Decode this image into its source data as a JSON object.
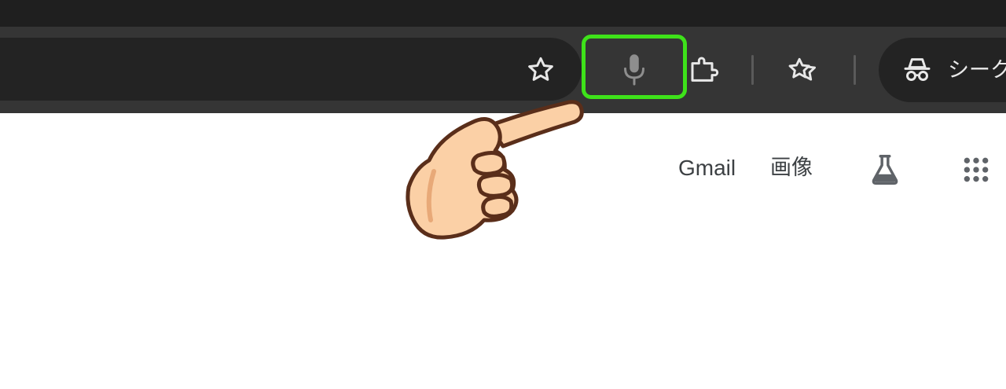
{
  "toolbar": {
    "star_icon": "star-icon",
    "mic_icon": "microphone-icon",
    "extension_icon": "extensions-icon",
    "bookmarks_icon": "bookmarks-icon",
    "profile": {
      "icon": "incognito-icon",
      "label": "シークレ"
    }
  },
  "annotation": {
    "highlight_color": "#3ee21a",
    "pointer_icon": "pointing-hand-icon"
  },
  "page": {
    "links": {
      "gmail": "Gmail",
      "images": "画像"
    },
    "labs_icon": "labs-flask-icon",
    "apps_icon": "apps-grid-icon"
  },
  "colors": {
    "tabstrip": "#1f1f1f",
    "toolbar": "#353535",
    "omnibox": "#232323",
    "page_background": "#ffffff",
    "link_text": "#3c4043"
  }
}
